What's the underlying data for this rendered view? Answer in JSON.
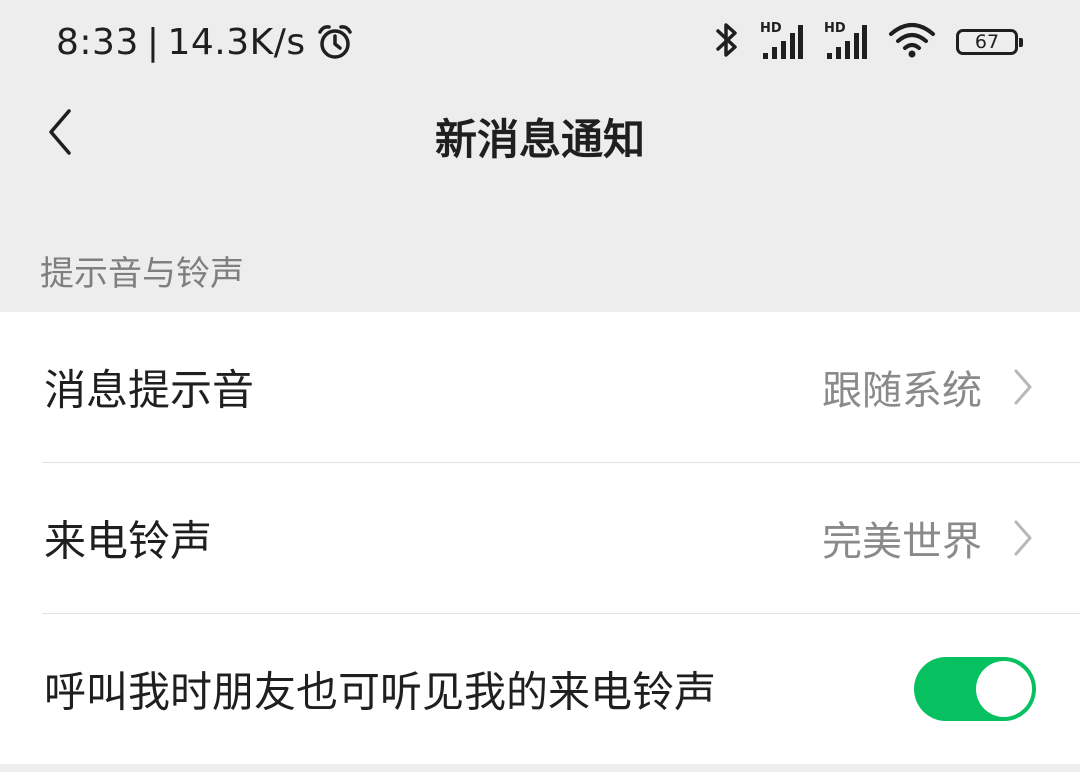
{
  "status_bar": {
    "time": "8:33",
    "separator": "|",
    "network_speed": "14.3K/s",
    "alarm_icon": "alarm-clock-icon",
    "bluetooth_icon": "bluetooth-icon",
    "signal_label_1": "HD",
    "signal_label_2": "HD",
    "wifi_icon": "wifi-icon",
    "battery_level": "67"
  },
  "nav": {
    "back_icon": "chevron-left-icon",
    "title": "新消息通知"
  },
  "section": {
    "header": "提示音与铃声"
  },
  "settings": {
    "items": [
      {
        "label": "消息提示音",
        "value": "跟随系统",
        "control": "chevron-right-icon"
      },
      {
        "label": "来电铃声",
        "value": "完美世界",
        "control": "chevron-right-icon"
      },
      {
        "label": "呼叫我时朋友也可听见我的来电铃声",
        "control": "toggle",
        "toggle_on": true
      }
    ]
  },
  "colors": {
    "background": "#ededed",
    "card": "#ffffff",
    "accent": "#07c160",
    "secondary_text": "#8a8a8a"
  }
}
